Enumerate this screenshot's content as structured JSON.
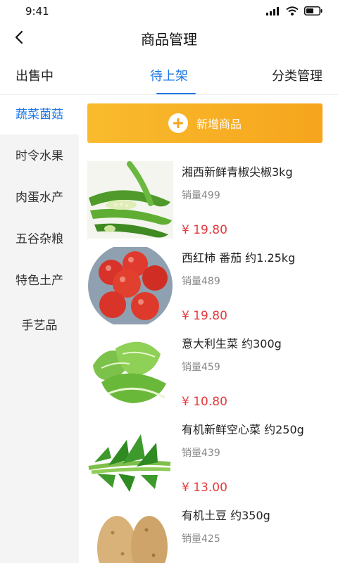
{
  "status": {
    "time": "9:41",
    "icons": [
      "signal-icon",
      "wifi-icon",
      "battery-icon"
    ]
  },
  "nav": {
    "title": "商品管理",
    "back_icon": "chevron-left-icon"
  },
  "tabs": [
    {
      "label": "出售中",
      "active": false
    },
    {
      "label": "待上架",
      "active": true
    },
    {
      "label": "分类管理",
      "active": false
    }
  ],
  "sidebar": {
    "items": [
      {
        "label": "蔬菜菌菇",
        "active": true
      },
      {
        "label": "时令水果",
        "active": false
      },
      {
        "label": "肉蛋水产",
        "active": false
      },
      {
        "label": "五谷杂粮",
        "active": false
      },
      {
        "label": "特色土产",
        "active": false
      },
      {
        "label": "手艺品",
        "active": false
      }
    ]
  },
  "add_button": {
    "label": "新增商品",
    "icon": "plus-circle-icon"
  },
  "products": [
    {
      "name": "湘西新鲜青椒尖椒3kg",
      "sales": "销量499",
      "price": "¥ 19.80",
      "image": "green-pepper-image"
    },
    {
      "name": "西红柿 番茄 约1.25kg",
      "sales": "销量489",
      "price": "¥ 19.80",
      "image": "tomato-image"
    },
    {
      "name": "意大利生菜 约300g",
      "sales": "销量459",
      "price": "¥ 10.80",
      "image": "lettuce-image"
    },
    {
      "name": "有机新鲜空心菜 约250g",
      "sales": "销量439",
      "price": "¥ 13.00",
      "image": "water-spinach-image"
    },
    {
      "name": "有机土豆 约350g",
      "sales": "销量425",
      "price": "",
      "image": "potato-image"
    }
  ],
  "colors": {
    "accent": "#1e78e6",
    "button": "#f7ae22",
    "price": "#e4393c",
    "sidebar_bg": "#f4f4f4"
  }
}
